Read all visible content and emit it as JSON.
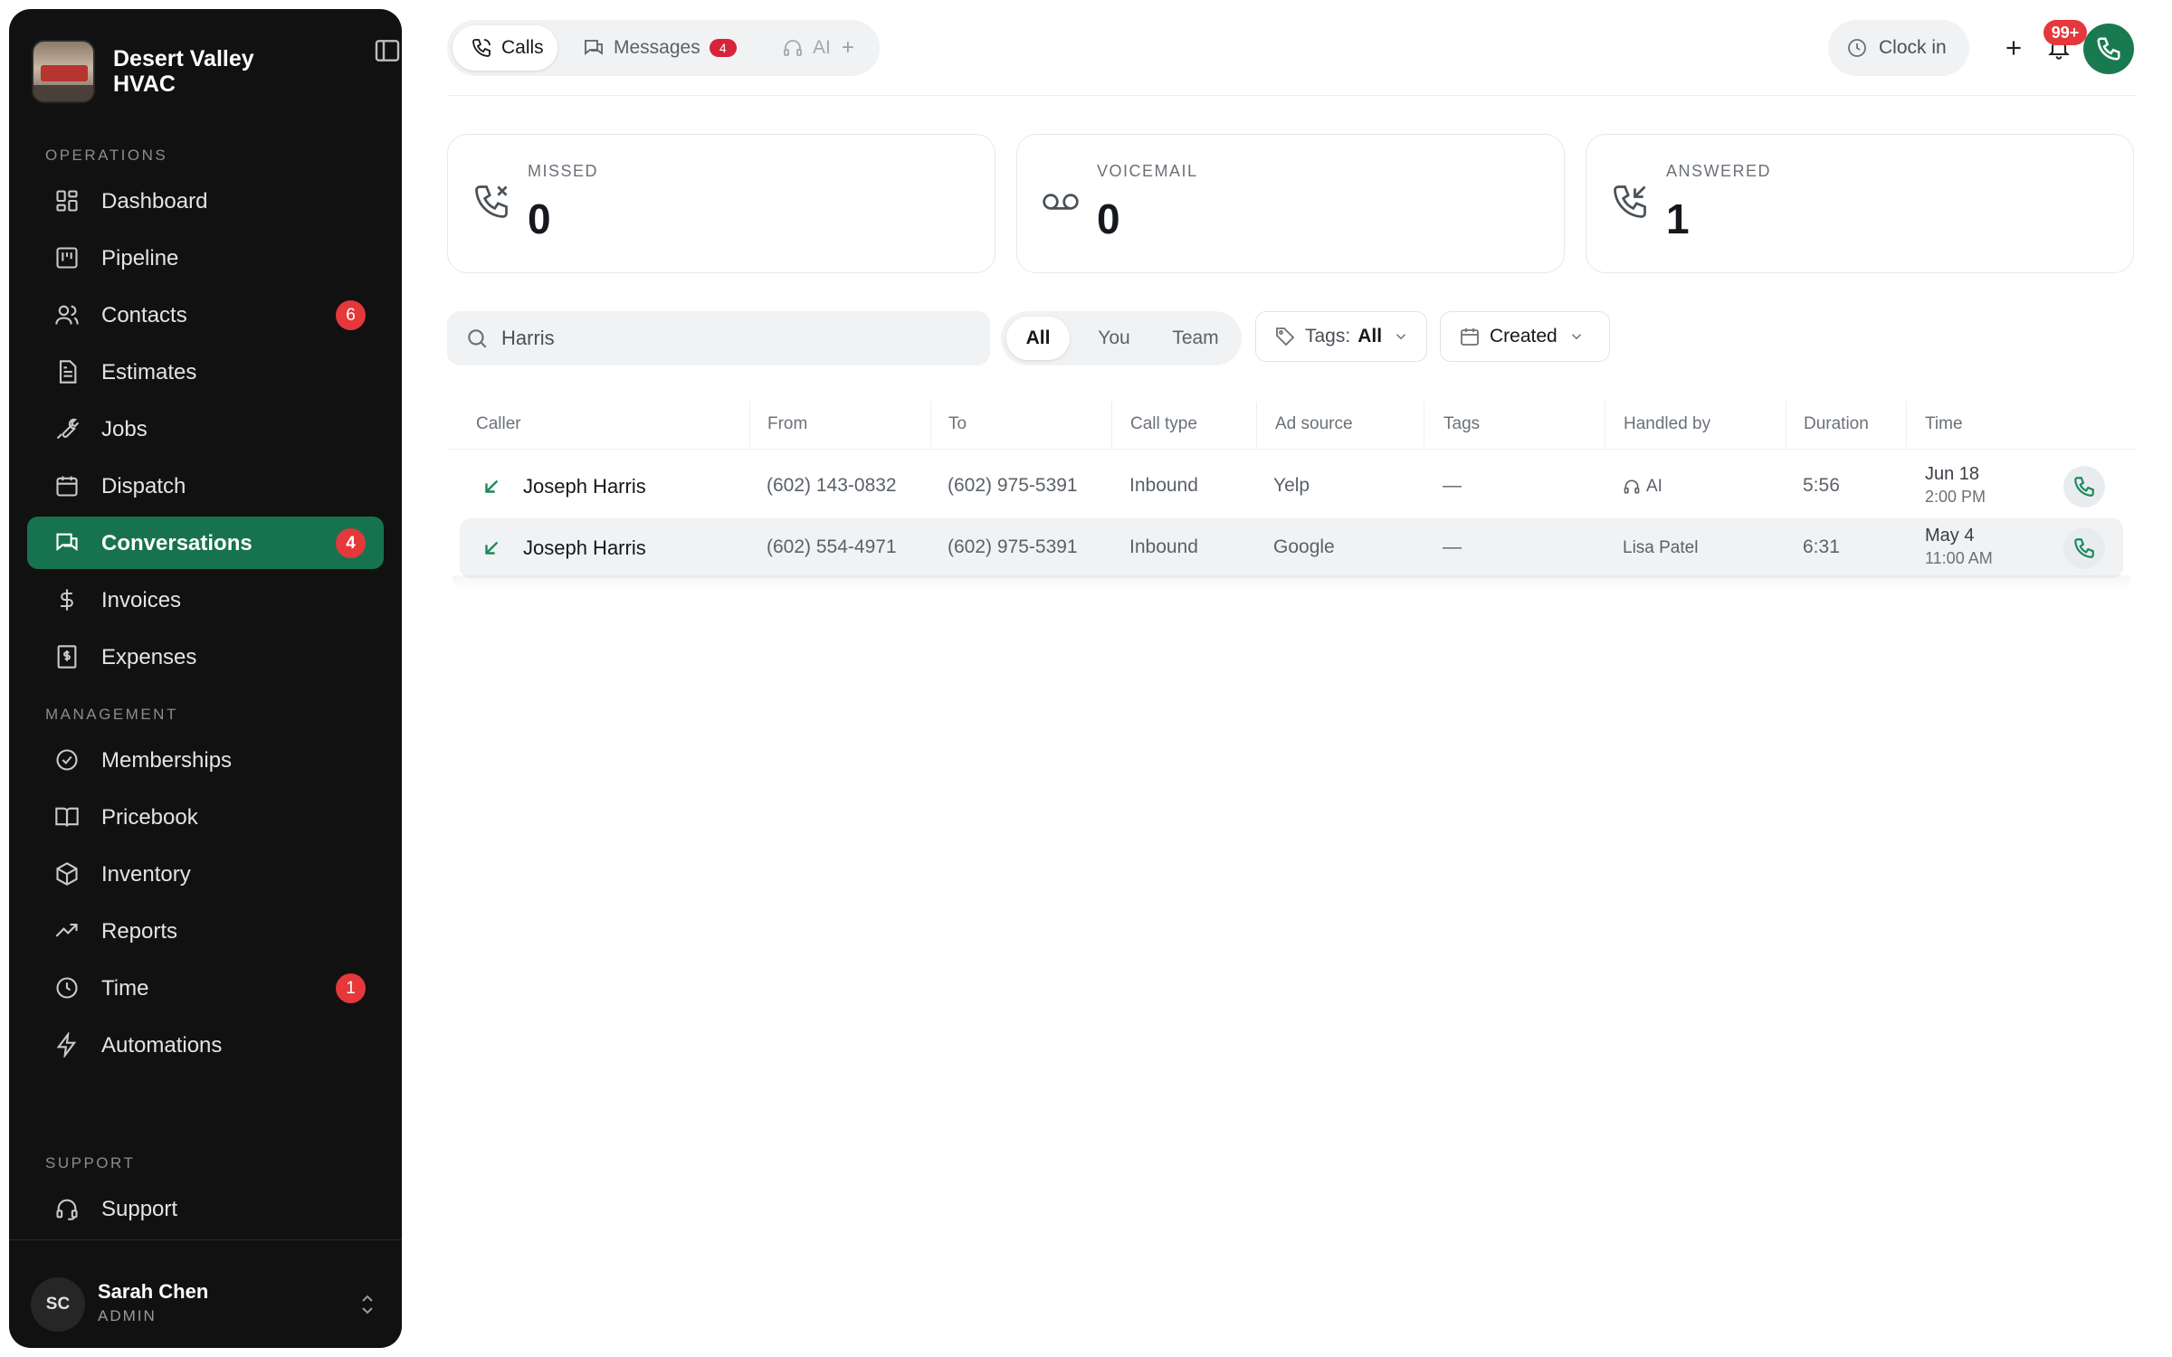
{
  "app": {
    "business_name": "Desert Valley HVAC"
  },
  "sidebar": {
    "sections": {
      "operations": "OPERATIONS",
      "management": "MANAGEMENT",
      "support": "SUPPORT"
    },
    "items": [
      {
        "label": "Dashboard",
        "icon": "grid-icon"
      },
      {
        "label": "Pipeline",
        "icon": "kanban-icon"
      },
      {
        "label": "Contacts",
        "icon": "users-icon",
        "badge": "6"
      },
      {
        "label": "Estimates",
        "icon": "document-icon"
      },
      {
        "label": "Jobs",
        "icon": "wrench-icon"
      },
      {
        "label": "Dispatch",
        "icon": "calendar-icon"
      },
      {
        "label": "Conversations",
        "icon": "chat-icon",
        "badge": "4",
        "active": true
      },
      {
        "label": "Invoices",
        "icon": "dollar-icon"
      },
      {
        "label": "Expenses",
        "icon": "receipt-icon"
      },
      {
        "label": "Memberships",
        "icon": "badge-check-icon"
      },
      {
        "label": "Pricebook",
        "icon": "book-icon"
      },
      {
        "label": "Inventory",
        "icon": "box-icon"
      },
      {
        "label": "Reports",
        "icon": "trend-icon"
      },
      {
        "label": "Time",
        "icon": "clock-icon",
        "badge": "1"
      },
      {
        "label": "Automations",
        "icon": "bolt-icon"
      },
      {
        "label": "Support",
        "icon": "headset-icon"
      }
    ],
    "user": {
      "initials": "SC",
      "name": "Sarah Chen",
      "role": "ADMIN"
    }
  },
  "topbar": {
    "tabs": [
      {
        "label": "Calls",
        "active": true
      },
      {
        "label": "Messages",
        "badge": "4"
      },
      {
        "label": "AI",
        "disabled": true
      }
    ],
    "clock_in_label": "Clock in",
    "notifications_badge": "99+"
  },
  "stats": [
    {
      "label": "MISSED",
      "value": "0",
      "icon": "phone-missed-icon"
    },
    {
      "label": "VOICEMAIL",
      "value": "0",
      "icon": "voicemail-icon"
    },
    {
      "label": "ANSWERED",
      "value": "1",
      "icon": "phone-incoming-icon"
    }
  ],
  "filters": {
    "search_value": "Harris",
    "scope_options": [
      "All",
      "You",
      "Team"
    ],
    "scope_selected": "All",
    "tags_label": "Tags:",
    "tags_value": "All",
    "sort_label": "Created"
  },
  "table": {
    "columns": [
      "Caller",
      "From",
      "To",
      "Call type",
      "Ad source",
      "Tags",
      "Handled by",
      "Duration",
      "Time"
    ],
    "rows": [
      {
        "caller": "Joseph Harris",
        "from": "(602) 143-0832",
        "to": "(602) 975-5391",
        "call_type": "Inbound",
        "ad_source": "Yelp",
        "tags": "—",
        "handled_by": "AI",
        "handled_icon": "headset-icon",
        "duration": "5:56",
        "date": "Jun 18",
        "time": "2:00 PM"
      },
      {
        "caller": "Joseph Harris",
        "from": "(602) 554-4971",
        "to": "(602) 975-5391",
        "call_type": "Inbound",
        "ad_source": "Google",
        "tags": "—",
        "handled_by": "Lisa Patel",
        "duration": "6:31",
        "date": "May 4",
        "time": "11:00 AM"
      }
    ]
  },
  "colors": {
    "sidebar_bg": "#111111",
    "accent_green": "#17734f",
    "badge_red": "#e5383b"
  }
}
